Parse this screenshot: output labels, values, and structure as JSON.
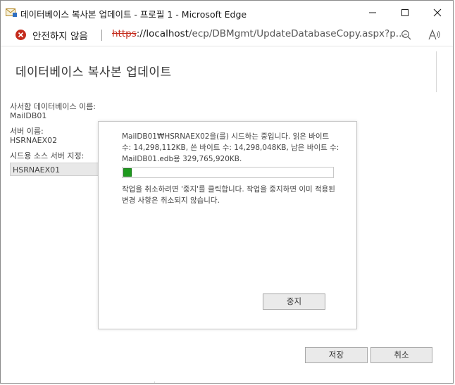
{
  "window": {
    "title": "데이터베이스 복사본 업데이트 - 프로필 1 - Microsoft Edge",
    "icon": "exchange-envelope-icon"
  },
  "addressbar": {
    "security_text": "안전하지 않음",
    "url_scheme": "https",
    "url_host": "://localhost",
    "url_path": "/ecp/DBMgmt/UpdateDatabaseCopy.aspx?p..."
  },
  "page": {
    "title": "데이터베이스 복사본 업데이트",
    "fields": [
      {
        "label": "사서함 데이터베이스 이름:",
        "value": "MailDB01"
      },
      {
        "label": "서버 이름:",
        "value": "HSRNAEX02"
      }
    ],
    "seed_source": {
      "label": "시드용 소스 서버 지정:",
      "value": "HSRNAEX01"
    }
  },
  "dialog": {
    "message": "MailDB01₩HSRNAEX02을(를) 시드하는 중입니다. 읽은 바이트 수: 14,298,112KB, 쓴 바이트 수: 14,298,048KB, 남은 바이트 수: MailDB01.edb용 329,765,920KB.",
    "progress_fraction": 0.042,
    "note": "작업을 취소하려면 '중지'를 클릭합니다. 작업을 중지하면 이미 적용된 변경 사항은 취소되지 않습니다.",
    "stop_label": "중지"
  },
  "footer": {
    "save_label": "저장",
    "cancel_label": "취소"
  },
  "colors": {
    "progress": "#1d9a1d",
    "insecure": "#c42b1c"
  }
}
